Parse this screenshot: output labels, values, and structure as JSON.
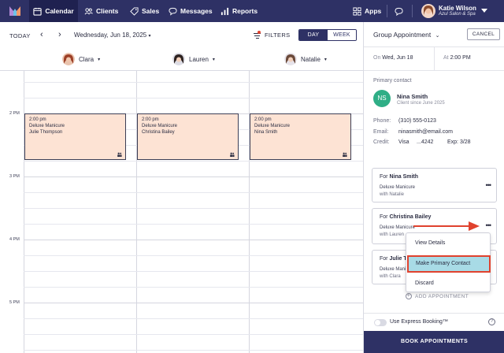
{
  "nav": {
    "items": [
      {
        "label": "Calendar",
        "icon": "calendar-icon",
        "active": true
      },
      {
        "label": "Clients",
        "icon": "clients-icon"
      },
      {
        "label": "Sales",
        "icon": "tag-icon"
      },
      {
        "label": "Messages",
        "icon": "chat-icon"
      },
      {
        "label": "Reports",
        "icon": "bar-chart-icon"
      }
    ],
    "apps_label": "Apps",
    "user": {
      "name": "Katie Wilson",
      "business": "Azul Salon & Spa"
    }
  },
  "toolbar": {
    "today": "TODAY",
    "date": "Wednesday, Jun 18, 2025",
    "filters": "FILTERS",
    "view_day": "DAY",
    "view_week": "WEEK"
  },
  "staff": [
    "Clara",
    "Lauren",
    "Natalie"
  ],
  "times": [
    "2 PM",
    "3 PM",
    "4 PM",
    "5 PM"
  ],
  "appointments": [
    {
      "time": "2:00 pm",
      "service": "Deluxe Manicure",
      "client": "Julie Thompson"
    },
    {
      "time": "2:00 pm",
      "service": "Deluxe Manicure",
      "client": "Christina Bailey"
    },
    {
      "time": "2:00 pm",
      "service": "Deluxe Manicure",
      "client": "Nina Smith"
    }
  ],
  "panel": {
    "title": "Group Appointment",
    "cancel": "CANCEL",
    "on_label": "On",
    "on_value": "Wed, Jun 18",
    "at_label": "At",
    "at_value": "2:00 PM",
    "primary_contact_label": "Primary contact",
    "client": {
      "initials": "NS",
      "name": "Nina Smith",
      "since": "Client since June 2025"
    },
    "phone_label": "Phone:",
    "phone": "(310) 555-0123",
    "email_label": "Email:",
    "email": "ninasmith@email.com",
    "credit_label": "Credit:",
    "credit": "Visa",
    "card_last": "...4242",
    "exp": "Exp: 3/28",
    "cards": [
      {
        "for": "For",
        "name": "Nina Smith",
        "service": "Deluxe Manicure",
        "with": "with Natalie"
      },
      {
        "for": "For",
        "name": "Christina Bailey",
        "service": "Deluxe Manicure",
        "with": "with Lauren"
      },
      {
        "for": "For",
        "name": "Julie Th",
        "service": "Deluxe Manicure",
        "with": "with Clara"
      }
    ],
    "add_appointment": "ADD APPOINTMENT",
    "express_booking": "Use Express Booking™",
    "help": "?",
    "book": "BOOK APPOINTMENTS"
  },
  "menu": {
    "items": [
      "View Details",
      "Make Primary Contact",
      "Discard"
    ]
  },
  "colors": {
    "nav": "#2e3165",
    "appt": "#fde3d4",
    "highlight": "#a8dbe6",
    "accent_red": "#e0422e",
    "client_green": "#2fae86"
  }
}
